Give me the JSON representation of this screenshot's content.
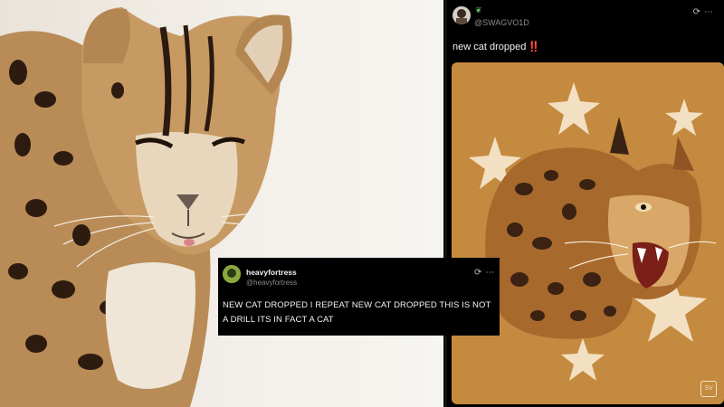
{
  "left_photo": {
    "subject": "Leopard cat photo"
  },
  "right_tweet": {
    "handle": "@SWAGVO1D",
    "text": "new cat dropped",
    "emphasis": "‼️",
    "icons": [
      "sync-icon",
      "more-icon"
    ],
    "watermark": "SV"
  },
  "overlay_tweet": {
    "display_name": "heavyfortress",
    "handle": "@heavyfortress",
    "text": "NEW CAT DROPPED I REPEAT NEW CAT DROPPED THIS IS NOT A DRILL ITS IN FACT A CAT",
    "icons": [
      "sync-icon",
      "more-icon"
    ]
  },
  "colors": {
    "art_bg": "#c48a3f",
    "dark": "#000000",
    "red": "#e0242f",
    "star": "#f3e0c2"
  }
}
